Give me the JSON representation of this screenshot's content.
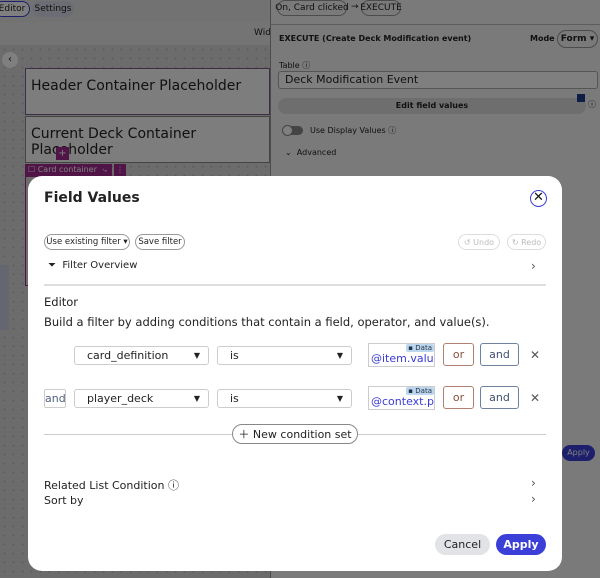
{
  "top_tabs": [
    "Editor",
    "Settings"
  ],
  "width_label": "Wid",
  "canvas": {
    "header_placeholder": "Header Container Placeholder",
    "deck_placeholder": "Current Deck Container Placeholder",
    "card_container_tag": "Card container",
    "add": "+"
  },
  "right_panel": {
    "breadcrumb": [
      "On, Card clicked",
      "EXECUTE"
    ],
    "title": "EXECUTE (Create Deck Modification event)",
    "mode_label": "Mode",
    "mode_value": "Form",
    "table_label": "Table",
    "table_value": "Deck Modification Event",
    "edit_field_values": "Edit field values",
    "use_display_values": "Use Display Values",
    "use_display_values_on": false,
    "advanced": "Advanced",
    "apply": "Apply"
  },
  "modal": {
    "title": "Field Values",
    "use_existing_filter": "Use existing filter",
    "save_filter": "Save filter",
    "undo": "Undo",
    "redo": "Redo",
    "filter_overview": "Filter Overview",
    "editor_heading": "Editor",
    "editor_description": "Build a filter by adding conditions that contain a field, operator, and value(s).",
    "conditions": [
      {
        "connector": "",
        "field": "card_definition",
        "operator": "is",
        "value": "@item.valu",
        "value_badge": "Data",
        "or": "or",
        "and": "and"
      },
      {
        "connector": "and",
        "field": "player_deck",
        "operator": "is",
        "value": "@context.p",
        "value_badge": "Data",
        "or": "or",
        "and": "and"
      }
    ],
    "new_condition_set": "New condition set",
    "related_list_condition": "Related List Condition",
    "sort_by": "Sort by",
    "cancel": "Cancel",
    "apply": "Apply",
    "accent": "#3b3fd8"
  }
}
